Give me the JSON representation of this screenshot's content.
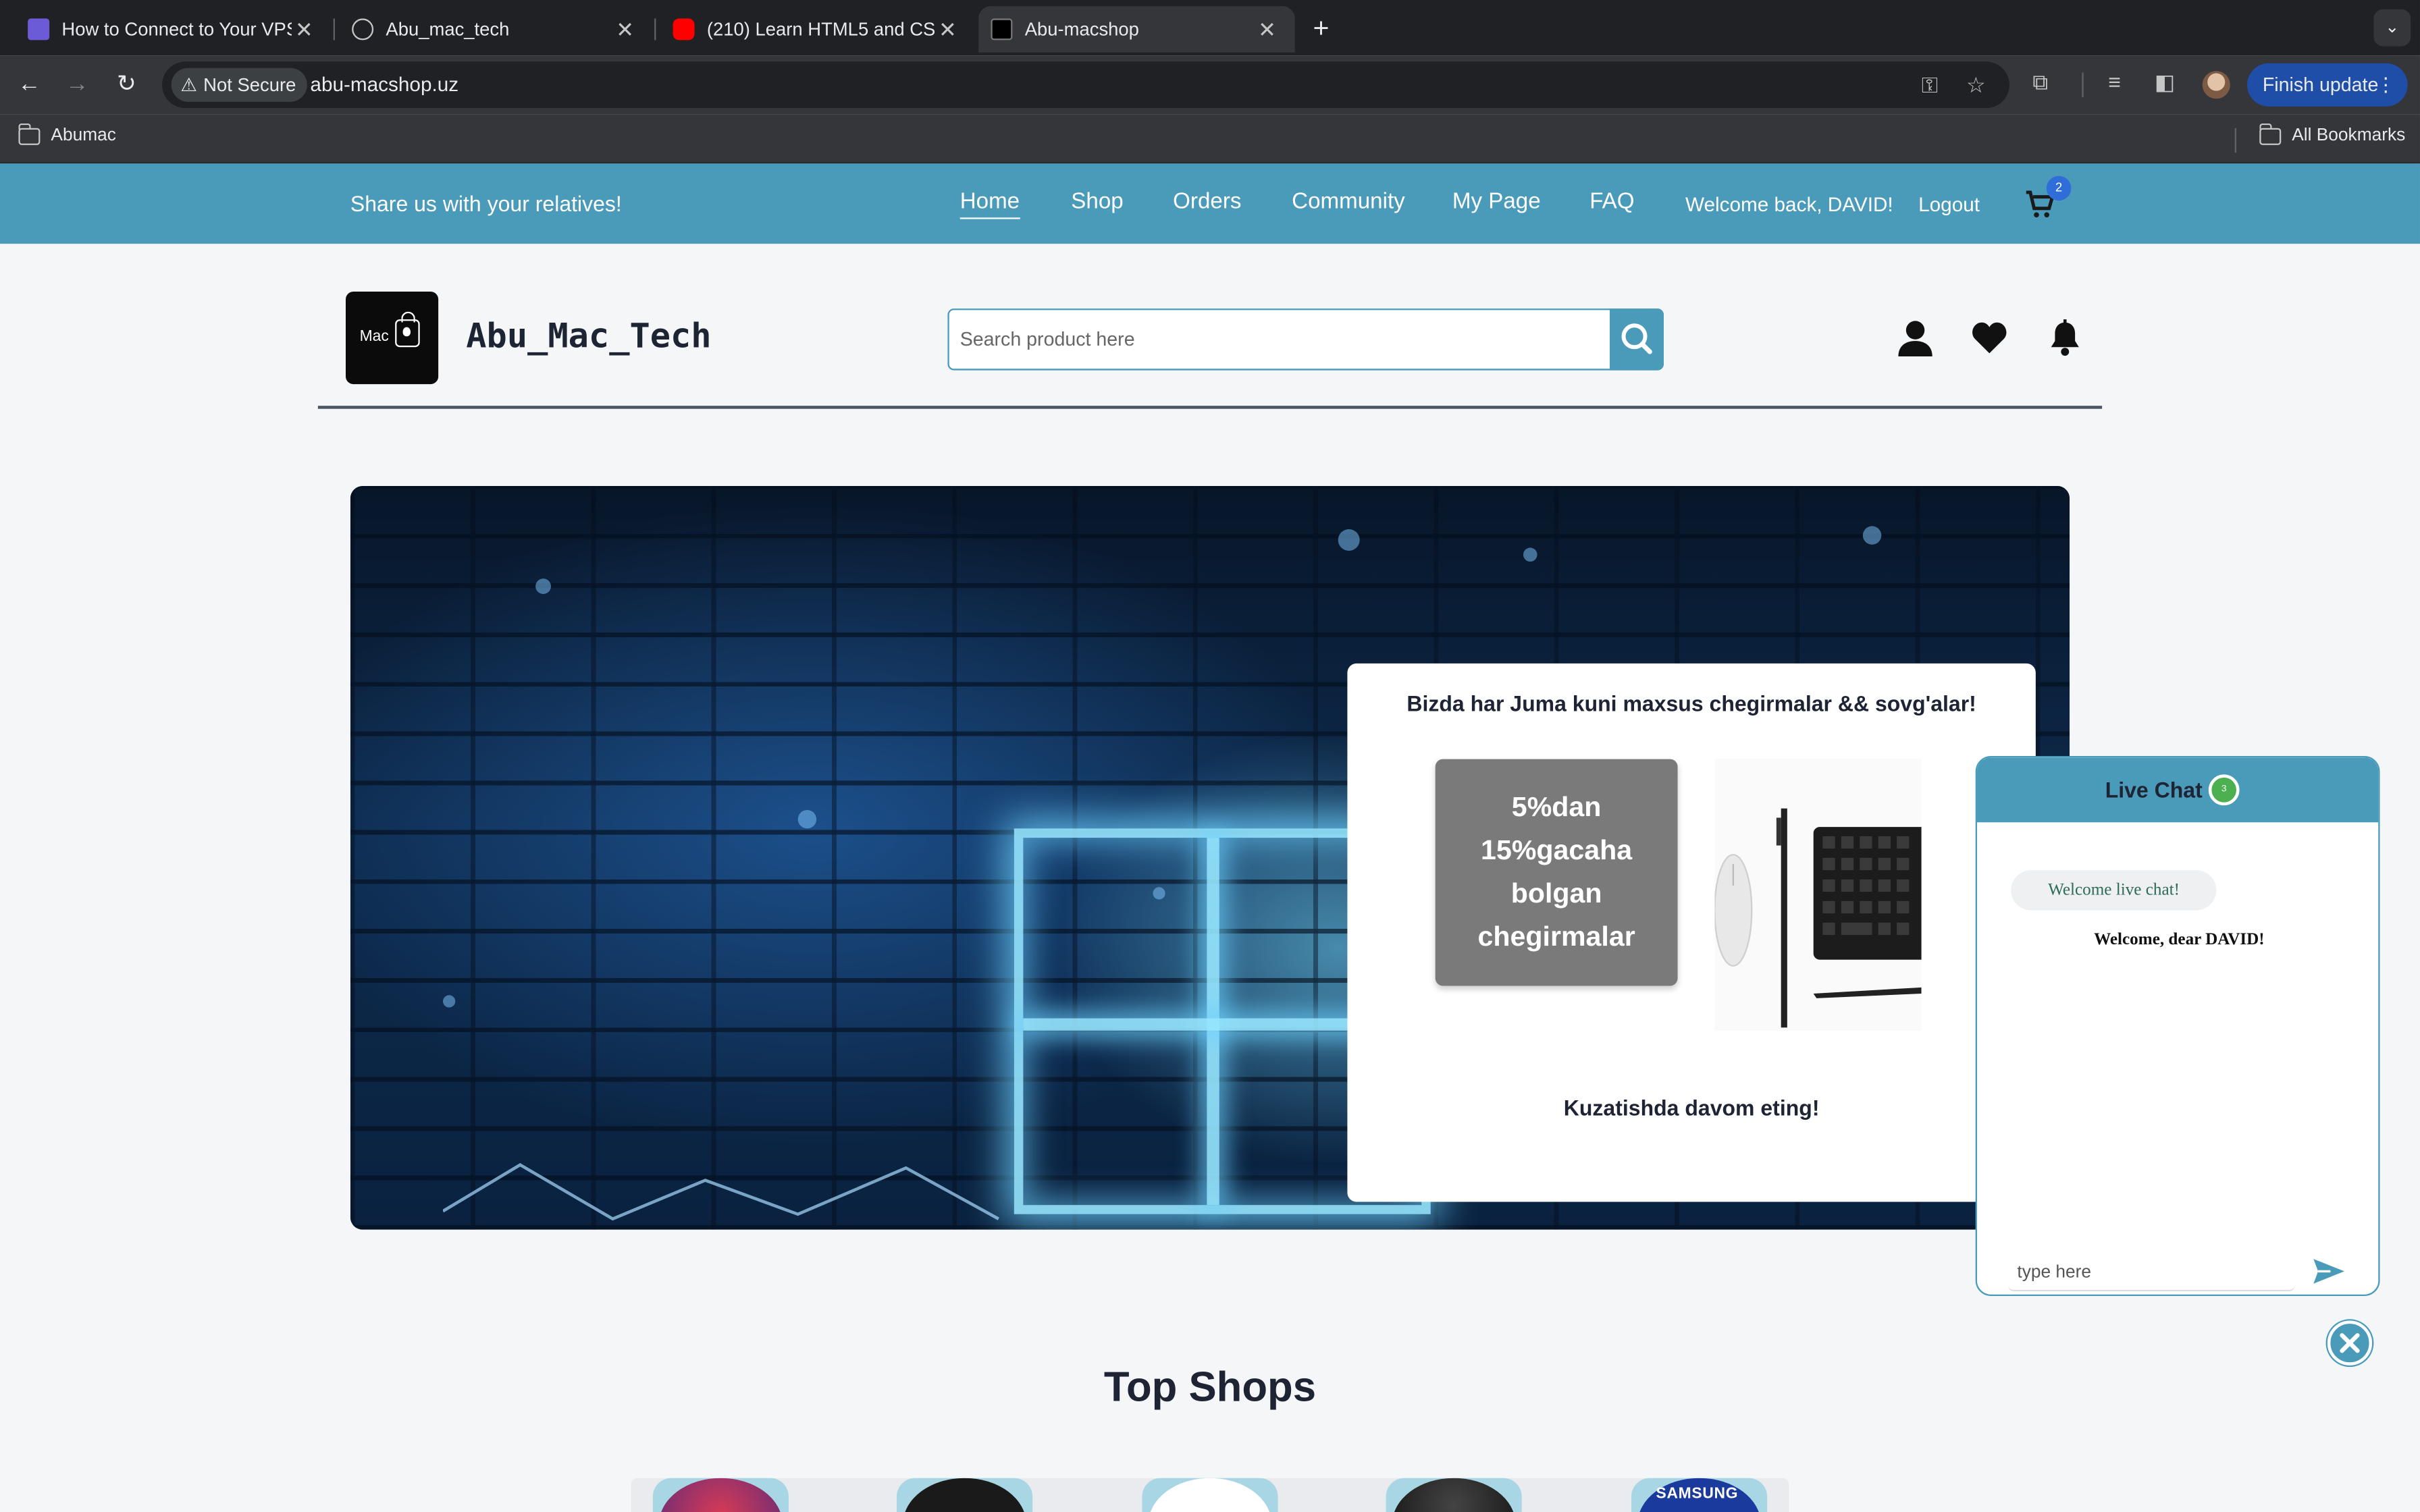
{
  "browser": {
    "tabs": [
      {
        "title": "How to Connect to Your VPS",
        "favicon_color": "#6b5bd6"
      },
      {
        "title": "Abu_mac_tech",
        "favicon_color": "#c4c7c5"
      },
      {
        "title": "(210) Learn HTML5 and CSS3",
        "favicon_color": "#ff0000"
      },
      {
        "title": "Abu-macshop",
        "favicon_color": "#000000",
        "active": true
      }
    ],
    "security_label": "Not Secure",
    "url": "abu-macshop.uz",
    "update_button": "Finish update",
    "bookmarks": [
      "Abumac",
      "All Bookmarks"
    ]
  },
  "site": {
    "topbar": {
      "share_text": "Share us with your relatives!",
      "nav": [
        "Home",
        "Shop",
        "Orders",
        "Community",
        "My Page",
        "FAQ"
      ],
      "active_nav": "Home",
      "welcome": "Welcome back, DAVID!",
      "logout": "Logout",
      "cart_count": "2"
    },
    "header": {
      "logo_text": "Mac",
      "brand": "Abu_Mac_Tech",
      "search_placeholder": "Search product here"
    },
    "promo": {
      "heading": "Bizda har Juma kuni maxsus chegirmalar && sovg'alar!",
      "discount_lines": [
        "5%dan",
        "15%gacaha",
        "bolgan",
        "chegirmalar"
      ],
      "footer": "Kuzatishda davom eting!"
    },
    "chat": {
      "title": "Live Chat",
      "online_count": "3",
      "bubble": "Welcome live chat!",
      "greeting": "Welcome, dear DAVID!",
      "input_placeholder": "type here"
    },
    "top_shops": {
      "title": "Top Shops",
      "partial_brand": "SAMSUNG"
    }
  },
  "colors": {
    "accent": "#4a9bb9",
    "dark_text": "#1e2433",
    "chrome_bg": "#202124"
  }
}
